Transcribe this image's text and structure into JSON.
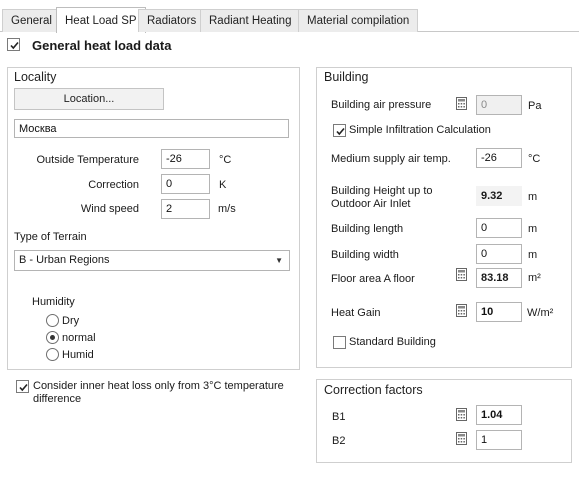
{
  "tabs": [
    {
      "label": "General",
      "active": false
    },
    {
      "label": "Heat Load SP",
      "active": true
    },
    {
      "label": "Radiators",
      "active": false
    },
    {
      "label": "Radiant Heating",
      "active": false
    },
    {
      "label": "Material compilation",
      "active": false
    }
  ],
  "header": {
    "title": "General heat load data",
    "checked": true
  },
  "locality": {
    "title": "Locality",
    "location_button": "Location...",
    "city": "Москва",
    "outside_temp": {
      "label": "Outside Temperature",
      "value": "-26",
      "unit": "°C"
    },
    "correction": {
      "label": "Correction",
      "value": "0",
      "unit": "K"
    },
    "wind_speed": {
      "label": "Wind speed",
      "value": "2",
      "unit": "m/s"
    },
    "terrain": {
      "label": "Type of Terrain",
      "selected": "B - Urban Regions"
    },
    "humidity": {
      "label": "Humidity",
      "options": [
        "Dry",
        "normal",
        "Humid"
      ],
      "selected": "normal"
    }
  },
  "inner_heat_loss": {
    "label": "Consider inner heat loss only from 3°C temperature difference",
    "checked": true
  },
  "building": {
    "title": "Building",
    "air_pressure": {
      "label": "Building air pressure",
      "value": "0",
      "unit": "Pa"
    },
    "simple_infiltration": {
      "label": "Simple Infiltration Calculation",
      "checked": true
    },
    "supply_air_temp": {
      "label": "Medium supply air temp.",
      "value": "-26",
      "unit": "°C"
    },
    "height_label_1": "Building Height up to",
    "height_label_2": "Outdoor Air Inlet",
    "height_value": "9.32",
    "height_unit": "m",
    "length": {
      "label": "Building length",
      "value": "0",
      "unit": "m"
    },
    "width": {
      "label": "Building width",
      "value": "0",
      "unit": "m"
    },
    "floor_area": {
      "label": "Floor area A floor",
      "value": "83.18",
      "unit": "m²"
    },
    "heat_gain": {
      "label": "Heat Gain",
      "value": "10",
      "unit": "W/m²"
    },
    "standard_building": {
      "label": "Standard Building",
      "checked": false
    }
  },
  "correction_factors": {
    "title": "Correction factors",
    "b1": {
      "label": "B1",
      "value": "1.04"
    },
    "b2": {
      "label": "B2",
      "value": "1"
    }
  },
  "icons": [
    "check-icon",
    "calculator-icon",
    "dropdown-arrow-icon"
  ]
}
